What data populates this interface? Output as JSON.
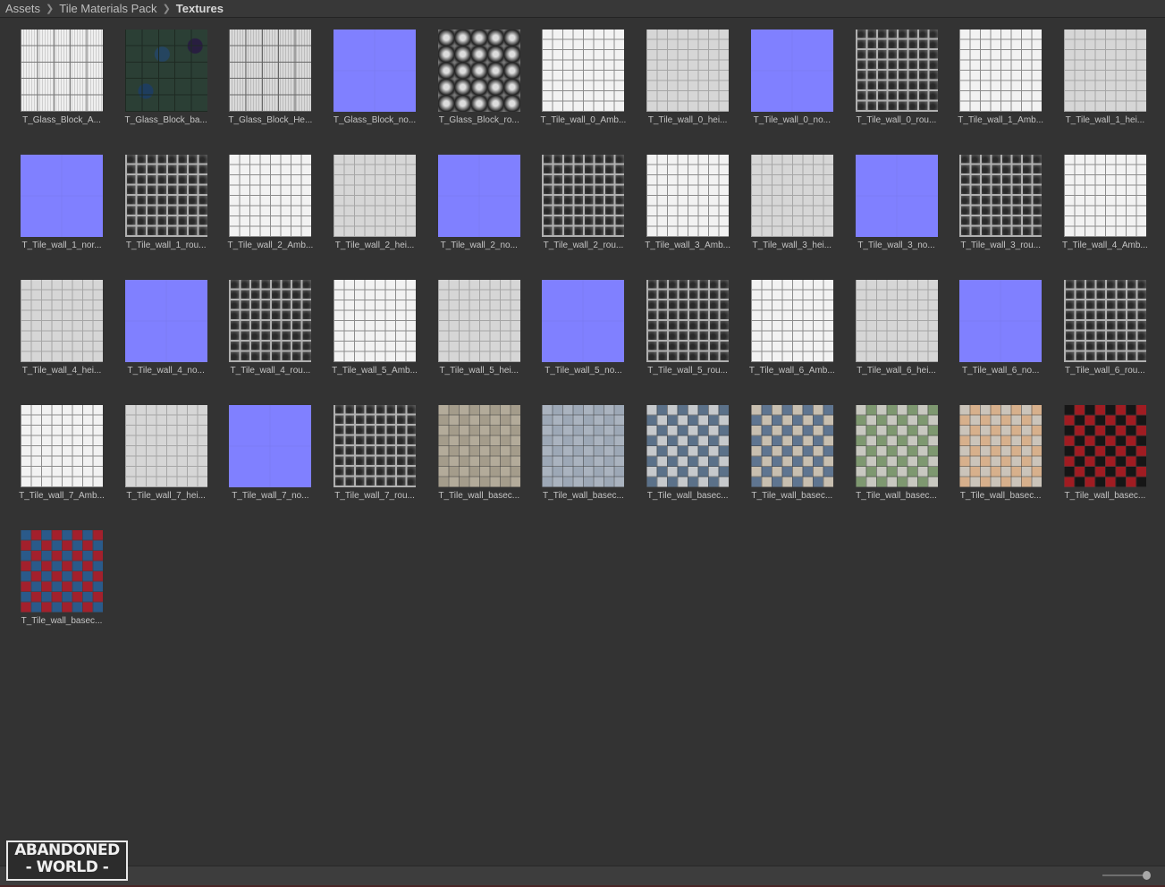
{
  "breadcrumb": [
    "Assets",
    "Tile Materials Pack",
    "Textures"
  ],
  "items": [
    {
      "label": "T_Glass_Block_A...",
      "preview": "glassA"
    },
    {
      "label": "T_Glass_Block_ba...",
      "preview": "glassB"
    },
    {
      "label": "T_Glass_Block_He...",
      "preview": "glassH"
    },
    {
      "label": "T_Glass_Block_no...",
      "preview": "nor"
    },
    {
      "label": "T_Glass_Block_ro...",
      "preview": "glassR"
    },
    {
      "label": "T_Tile_wall_0_Amb...",
      "preview": "amb"
    },
    {
      "label": "T_Tile_wall_0_hei...",
      "preview": "hei"
    },
    {
      "label": "T_Tile_wall_0_no...",
      "preview": "nor"
    },
    {
      "label": "T_Tile_wall_0_rou...",
      "preview": "rou"
    },
    {
      "label": "T_Tile_wall_1_Amb...",
      "preview": "amb"
    },
    {
      "label": "T_Tile_wall_1_hei...",
      "preview": "hei"
    },
    {
      "label": "T_Tile_wall_1_nor...",
      "preview": "nor"
    },
    {
      "label": "T_Tile_wall_1_rou...",
      "preview": "rou"
    },
    {
      "label": "T_Tile_wall_2_Amb...",
      "preview": "amb"
    },
    {
      "label": "T_Tile_wall_2_hei...",
      "preview": "hei"
    },
    {
      "label": "T_Tile_wall_2_no...",
      "preview": "nor"
    },
    {
      "label": "T_Tile_wall_2_rou...",
      "preview": "rou"
    },
    {
      "label": "T_Tile_wall_3_Amb...",
      "preview": "amb"
    },
    {
      "label": "T_Tile_wall_3_hei...",
      "preview": "hei"
    },
    {
      "label": "T_Tile_wall_3_no...",
      "preview": "nor"
    },
    {
      "label": "T_Tile_wall_3_rou...",
      "preview": "rou"
    },
    {
      "label": "T_Tile_wall_4_Amb...",
      "preview": "amb"
    },
    {
      "label": "T_Tile_wall_4_hei...",
      "preview": "hei"
    },
    {
      "label": "T_Tile_wall_4_no...",
      "preview": "nor"
    },
    {
      "label": "T_Tile_wall_4_rou...",
      "preview": "rou"
    },
    {
      "label": "T_Tile_wall_5_Amb...",
      "preview": "amb"
    },
    {
      "label": "T_Tile_wall_5_hei...",
      "preview": "hei"
    },
    {
      "label": "T_Tile_wall_5_no...",
      "preview": "nor"
    },
    {
      "label": "T_Tile_wall_5_rou...",
      "preview": "rou"
    },
    {
      "label": "T_Tile_wall_6_Amb...",
      "preview": "amb"
    },
    {
      "label": "T_Tile_wall_6_hei...",
      "preview": "hei"
    },
    {
      "label": "T_Tile_wall_6_no...",
      "preview": "nor"
    },
    {
      "label": "T_Tile_wall_6_rou...",
      "preview": "rou"
    },
    {
      "label": "T_Tile_wall_7_Amb...",
      "preview": "amb"
    },
    {
      "label": "T_Tile_wall_7_hei...",
      "preview": "hei"
    },
    {
      "label": "T_Tile_wall_7_no...",
      "preview": "nor"
    },
    {
      "label": "T_Tile_wall_7_rou...",
      "preview": "rou"
    },
    {
      "label": "T_Tile_wall_basec...",
      "preview": "checker",
      "colors": [
        "#a49c8b",
        "#b3ab9a"
      ]
    },
    {
      "label": "T_Tile_wall_basec...",
      "preview": "checker",
      "colors": [
        "#9da8b6",
        "#aab3bf"
      ]
    },
    {
      "label": "T_Tile_wall_basec...",
      "preview": "checker",
      "colors": [
        "#5b7189",
        "#c6c9cc"
      ]
    },
    {
      "label": "T_Tile_wall_basec...",
      "preview": "checker",
      "colors": [
        "#5f7590",
        "#c8bfb0"
      ]
    },
    {
      "label": "T_Tile_wall_basec...",
      "preview": "checker",
      "colors": [
        "#7e9870",
        "#c8c8c0"
      ]
    },
    {
      "label": "T_Tile_wall_basec...",
      "preview": "checker",
      "colors": [
        "#d7b08c",
        "#cbc4ba"
      ]
    },
    {
      "label": "T_Tile_wall_basec...",
      "preview": "checker",
      "colors": [
        "#a01c22",
        "#161616"
      ]
    },
    {
      "label": "T_Tile_wall_basec...",
      "preview": "checker",
      "colors": [
        "#a3202c",
        "#2a5a8a"
      ]
    }
  ],
  "logo": {
    "line1": "ABANDONED",
    "line2": "- WORLD -"
  }
}
